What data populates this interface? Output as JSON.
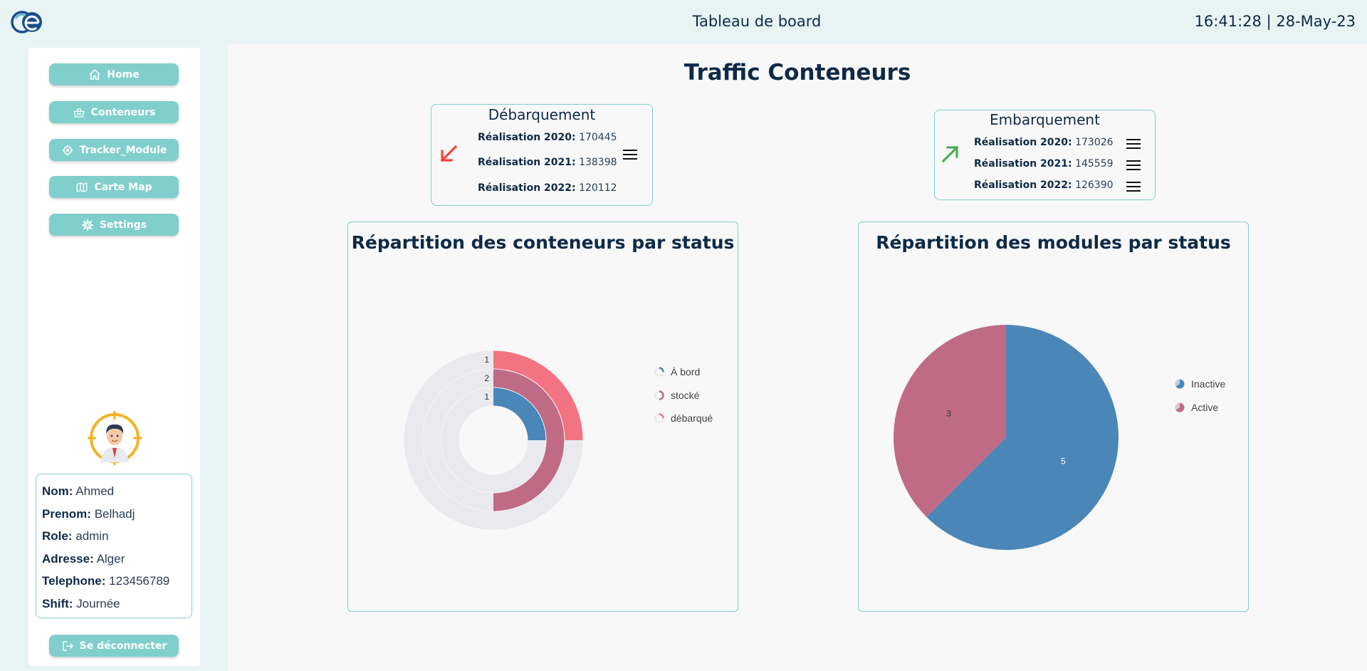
{
  "header": {
    "title": "Tableau de board",
    "time": "16:41:28",
    "separator": "|",
    "date": "28-May-23"
  },
  "sidebar": {
    "nav": [
      {
        "label": "Home",
        "icon": "home-icon"
      },
      {
        "label": "Conteneurs",
        "icon": "basket-icon"
      },
      {
        "label": "Tracker_Module",
        "icon": "target-icon"
      },
      {
        "label": "Carte Map",
        "icon": "map-icon"
      },
      {
        "label": "Settings",
        "icon": "gear-icon"
      }
    ],
    "user": [
      {
        "key": "Nom:",
        "value": "Ahmed"
      },
      {
        "key": "Prenom:",
        "value": "Belhadj"
      },
      {
        "key": "Role:",
        "value": "admin"
      },
      {
        "key": "Adresse:",
        "value": "Alger"
      },
      {
        "key": "Telephone:",
        "value": "123456789"
      },
      {
        "key": "Shift:",
        "value": "Journée"
      }
    ],
    "logout_label": "Se déconnecter",
    "logout_icon": "logout-icon"
  },
  "main": {
    "title": "Traffic Conteneurs",
    "debarquement": {
      "title": "Débarquement",
      "trend": "down",
      "trend_color": "#f44336",
      "rows": [
        {
          "key": "Réalisation 2020:",
          "value": "170445"
        },
        {
          "key": "Réalisation 2021:",
          "value": "138398"
        },
        {
          "key": "Réalisation 2022:",
          "value": "120112"
        }
      ]
    },
    "embarquement": {
      "title": "Embarquement",
      "trend": "up",
      "trend_color": "#4caf50",
      "rows": [
        {
          "key": "Réalisation 2020:",
          "value": "173026"
        },
        {
          "key": "Réalisation 2021:",
          "value": "145559"
        },
        {
          "key": "Réalisation 2022:",
          "value": "126390"
        }
      ]
    }
  },
  "colors": {
    "accent": "#80cfcc",
    "navy": "#0e2a47",
    "blue": "#4a86b8",
    "mauve": "#c06b85",
    "pink": "#f27382",
    "track": "#e9e9ee"
  },
  "chart_data": [
    {
      "type": "radial-bar",
      "title": "Répartition des conteneurs par status",
      "max": 4,
      "series": [
        {
          "name": "À bord",
          "value": 1,
          "color": "#4a86b8"
        },
        {
          "name": "stocké",
          "value": 2,
          "color": "#c06b85"
        },
        {
          "name": "débarqué",
          "value": 1,
          "color": "#f27382"
        }
      ],
      "legend_position": "right"
    },
    {
      "type": "pie",
      "title": "Répartition des modules par status",
      "series": [
        {
          "name": "Inactive",
          "value": 5,
          "color": "#4a86b8"
        },
        {
          "name": "Active",
          "value": 3,
          "color": "#c06b85"
        }
      ],
      "legend_position": "right"
    }
  ]
}
